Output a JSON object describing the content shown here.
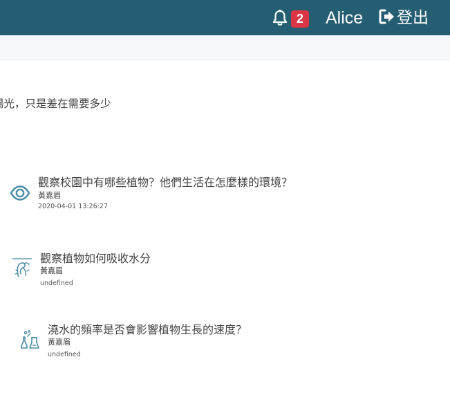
{
  "header": {
    "notification_count": "2",
    "user_name": "Alice",
    "logout_label": "登出",
    "bar_color": "#255e73",
    "badge_color": "#dc3545"
  },
  "intro_text": "陽光，只是差在需要多少",
  "items": [
    {
      "icon": "eye-icon",
      "title": "觀察校園中有哪些植物？他們生活在怎麼樣的環境？",
      "author": "黃嘉眉",
      "time": "2020-04-01 13:26:27"
    },
    {
      "icon": "plant-drawing-icon",
      "title": "觀察植物如何吸收水分",
      "author": "黃嘉眉",
      "time": "undefined"
    },
    {
      "icon": "lab-flask-icon",
      "title": "澆水的頻率是否會影響植物生長的速度？",
      "author": "黃嘉眉",
      "time": "undefined"
    }
  ],
  "accent_color": "#4a8ba6"
}
